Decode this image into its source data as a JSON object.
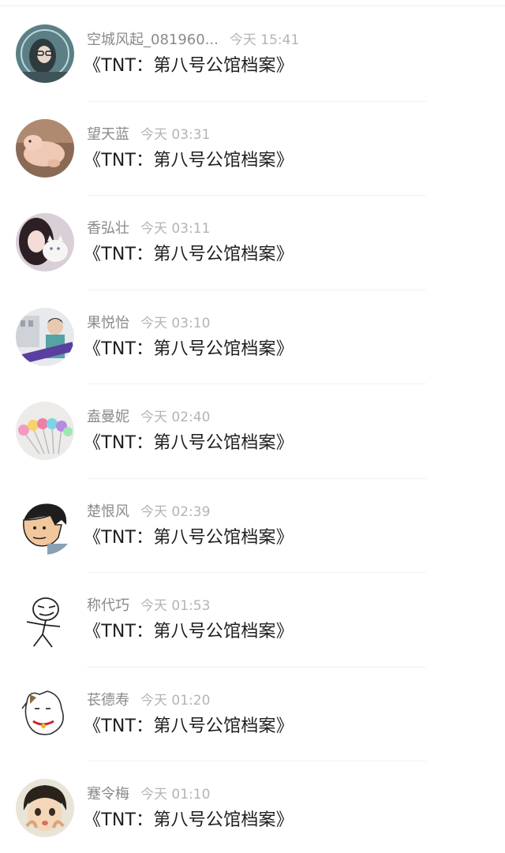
{
  "comments": [
    {
      "name": "空城风起_081960...",
      "time": "今天 15:41",
      "text": "《TNT：第八号公馆档案》",
      "avatar": "avatar-girl-glasses"
    },
    {
      "name": "望天蓝",
      "time": "今天 03:31",
      "text": "《TNT：第八号公馆档案》",
      "avatar": "avatar-pig"
    },
    {
      "name": "香弘壮",
      "time": "今天 03:11",
      "text": "《TNT：第八号公馆档案》",
      "avatar": "avatar-girl-cat"
    },
    {
      "name": "果悦怡",
      "time": "今天 03:10",
      "text": "《TNT：第八号公馆档案》",
      "avatar": "avatar-boy-street"
    },
    {
      "name": "盍曼妮",
      "time": "今天 02:40",
      "text": "《TNT：第八号公馆档案》",
      "avatar": "avatar-pom-pom-pens"
    },
    {
      "name": "楚恨风",
      "time": "今天 02:39",
      "text": "《TNT：第八号公馆档案》",
      "avatar": "avatar-cartoon-man"
    },
    {
      "name": "称代巧",
      "time": "今天 01:53",
      "text": "《TNT：第八号公馆档案》",
      "avatar": "avatar-meme-face"
    },
    {
      "name": "苌德寿",
      "time": "今天 01:20",
      "text": "《TNT：第八号公馆档案》",
      "avatar": "avatar-lucky-cat"
    },
    {
      "name": "蹇令梅",
      "time": "今天 01:10",
      "text": "《TNT：第八号公馆档案》",
      "avatar": "avatar-anime-kid"
    }
  ]
}
